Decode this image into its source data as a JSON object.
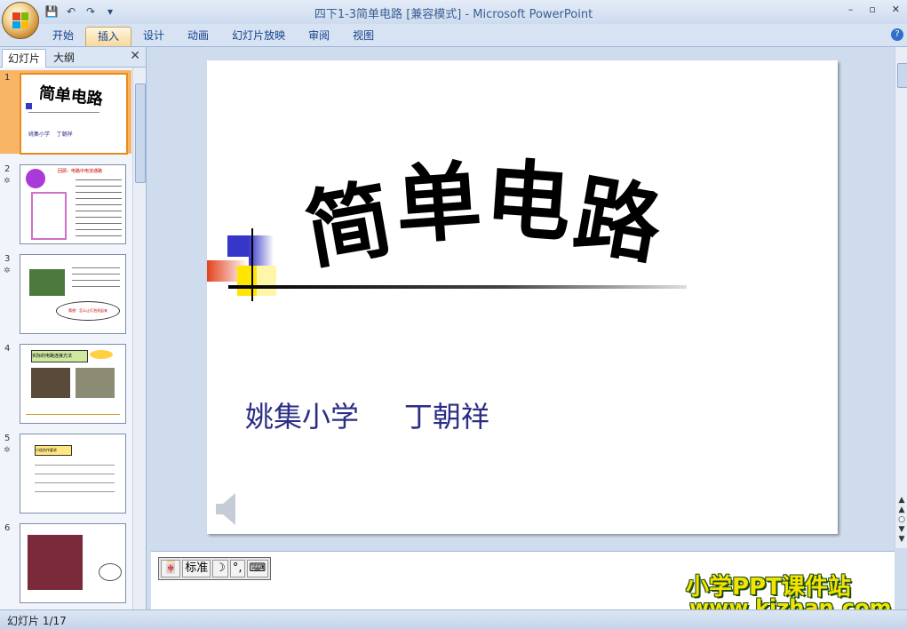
{
  "window": {
    "title": "四下1-3简单电路 [兼容模式] - Microsoft PowerPoint",
    "controls": [
      "–",
      "▫",
      "✕"
    ]
  },
  "qat": {
    "save_icon": "save-icon",
    "undo_icon": "undo-icon",
    "redo_icon": "redo-icon",
    "more": "▾"
  },
  "ribbon": {
    "tabs": [
      "开始",
      "插入",
      "设计",
      "动画",
      "幻灯片放映",
      "审阅",
      "视图"
    ],
    "active_tab": "插入",
    "help": "?"
  },
  "left_pane": {
    "tabs": [
      "幻灯片",
      "大纲"
    ],
    "close": "✕",
    "slides": [
      {
        "num": "1",
        "anim": "",
        "title": "简单电路",
        "sub": "姚集小学    丁朝祥"
      },
      {
        "num": "2",
        "anim": "✲",
        "caption": "回顾：电路中电流通路"
      },
      {
        "num": "3",
        "anim": "✲",
        "caption": "猜想：怎么让灯泡亮起来"
      },
      {
        "num": "4",
        "anim": "",
        "caption": "实际的电路连接方法"
      },
      {
        "num": "5",
        "anim": "✲",
        "caption": "小组合作要求"
      },
      {
        "num": "6",
        "anim": "",
        "caption": ""
      }
    ]
  },
  "slide": {
    "title_chars": [
      "简",
      "单",
      "电",
      "路"
    ],
    "subtitle": "姚集小学     丁朝祥"
  },
  "ime": {
    "icon": "ime-icon",
    "mode": "标准",
    "moon": "☽",
    "punct": "°,",
    "keyboard": "keyboard-icon"
  },
  "watermark": {
    "line1": "小学PPT课件站",
    "line2": "www.kjzhan.com"
  },
  "status": {
    "slide_counter": "幻灯片 1/17"
  },
  "colors": {
    "ribbon": "#d7e3f3",
    "accent": "#15428b",
    "subtitle": "#2b2d86",
    "selected_thumb": "#f8b566"
  }
}
